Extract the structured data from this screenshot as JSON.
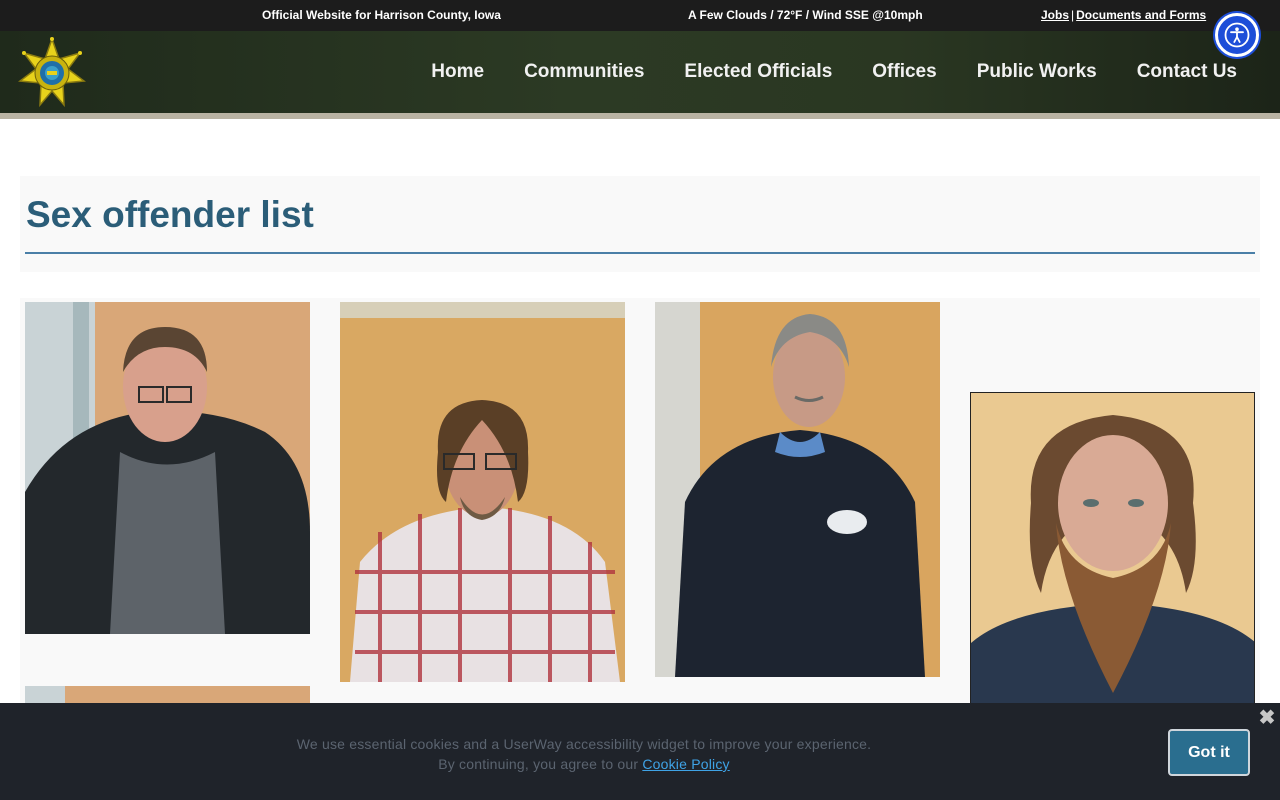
{
  "topbar": {
    "official": "Official Website for Harrison County, Iowa",
    "weather": "A Few Clouds / 72°F / Wind SSE @10mph",
    "jobs_link": "Jobs",
    "separator": "|",
    "docs_link": "Documents and Forms"
  },
  "nav": {
    "items": [
      "Home",
      "Communities",
      "Elected Officials",
      "Offices",
      "Public Works",
      "Contact Us"
    ]
  },
  "page": {
    "title": "Sex offender list"
  },
  "gallery": {
    "photos": [
      {
        "alt": "Offender photo 1"
      },
      {
        "alt": "Offender photo 2"
      },
      {
        "alt": "Offender photo 3"
      },
      {
        "alt": "Offender photo 4"
      },
      {
        "alt": "Offender photo 5"
      }
    ]
  },
  "cookie": {
    "line1": "We use essential cookies and a UserWay accessibility widget to improve your experience.",
    "line2": "By continuing, you agree to our",
    "policy_link": "Cookie Policy",
    "button": "Got it",
    "close": "✖"
  },
  "icons": {
    "accessibility": "accessibility-icon",
    "logo": "sheriff-star-badge"
  },
  "colors": {
    "accent": "#2b5d78",
    "nav_bg": "#2c3a24",
    "cookie_bg": "#1f232a",
    "a11y_blue": "#1d4ed8"
  }
}
